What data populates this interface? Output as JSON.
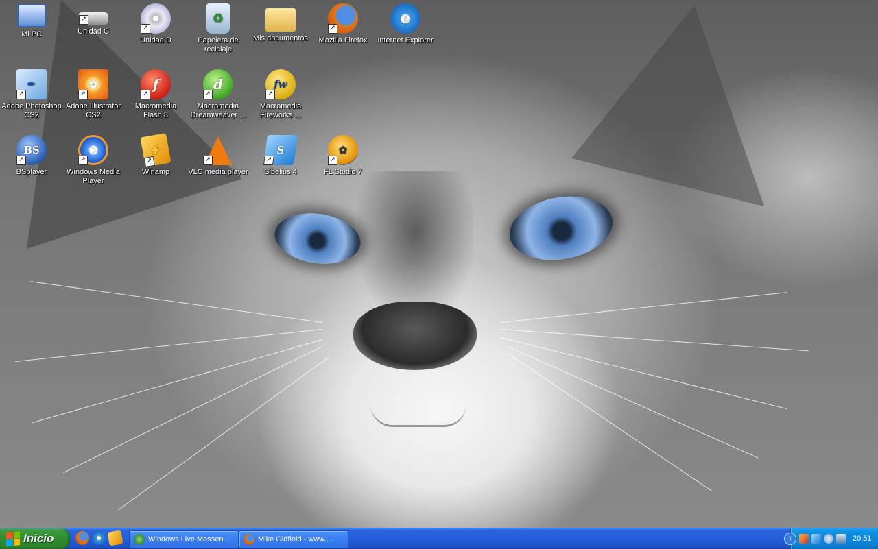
{
  "desktop": {
    "icons": [
      {
        "label": "Mi PC",
        "icon": "computer-icon",
        "shortcut": false
      },
      {
        "label": "Unidad C",
        "icon": "drive-c-icon",
        "shortcut": true
      },
      {
        "label": "Unidad D",
        "icon": "cd-drive-icon",
        "shortcut": true
      },
      {
        "label": "Papelera de reciclaje",
        "icon": "recycle-bin-icon",
        "shortcut": false
      },
      {
        "label": "Mis documentos",
        "icon": "folder-icon",
        "shortcut": false
      },
      {
        "label": "Mozilla Firefox",
        "icon": "firefox-icon",
        "shortcut": true
      },
      {
        "label": "Internet Explorer",
        "icon": "internet-explorer-icon",
        "shortcut": false
      },
      {
        "label": "Adobe Photoshop CS2",
        "icon": "photoshop-icon",
        "shortcut": true
      },
      {
        "label": "Adobe Illustrator CS2",
        "icon": "illustrator-icon",
        "shortcut": true
      },
      {
        "label": "Macromedia Flash 8",
        "icon": "flash-icon",
        "shortcut": true
      },
      {
        "label": "Macromedia Dreamweaver ...",
        "icon": "dreamweaver-icon",
        "shortcut": true
      },
      {
        "label": "Macromedia Fireworks ...",
        "icon": "fireworks-icon",
        "shortcut": true
      },
      {
        "label": "BSplayer",
        "icon": "bsplayer-icon",
        "shortcut": true
      },
      {
        "label": "Windows Media Player",
        "icon": "windows-media-player-icon",
        "shortcut": true
      },
      {
        "label": "Winamp",
        "icon": "winamp-icon",
        "shortcut": true
      },
      {
        "label": "VLC media player",
        "icon": "vlc-icon",
        "shortcut": true
      },
      {
        "label": "Sibelius 4",
        "icon": "sibelius-icon",
        "shortcut": true
      },
      {
        "label": "FL Studio 7",
        "icon": "fl-studio-icon",
        "shortcut": true
      }
    ],
    "wallpaper": "cat-face-wallpaper"
  },
  "taskbar": {
    "start_label": "Inicio",
    "quick_launch": [
      {
        "icon": "firefox-icon"
      },
      {
        "icon": "internet-explorer-icon"
      },
      {
        "icon": "winamp-icon"
      }
    ],
    "buttons": [
      {
        "label": "Windows Live Messen...",
        "icon": "messenger-icon"
      },
      {
        "label": "Mike Oldfield - www....",
        "icon": "firefox-icon"
      }
    ],
    "tray": {
      "icons": [
        "show-hidden-icons-icon",
        "app-tray-icon",
        "network-tray-icon",
        "messenger-tray-icon",
        "display-tray-icon"
      ],
      "clock": "20:51"
    }
  },
  "colors": {
    "taskbar_blue": "#245edb",
    "start_green": "#3c9a3c",
    "tray_blue": "#0c81d6"
  }
}
